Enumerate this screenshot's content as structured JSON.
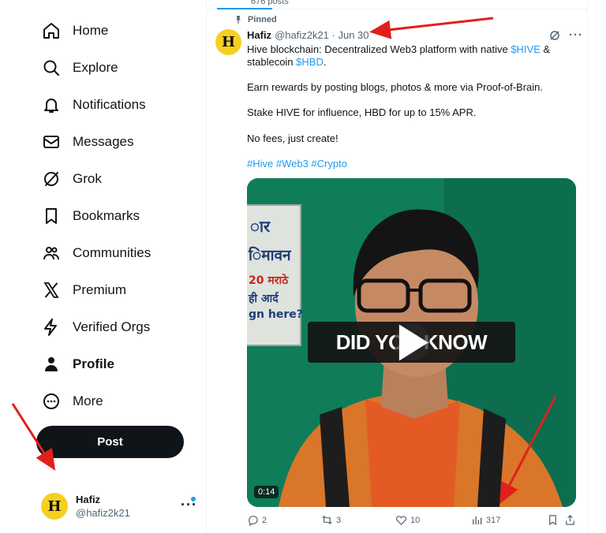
{
  "sidebar": {
    "items": [
      {
        "label": "Home",
        "icon": "home-icon"
      },
      {
        "label": "Explore",
        "icon": "search-icon"
      },
      {
        "label": "Notifications",
        "icon": "bell-icon"
      },
      {
        "label": "Messages",
        "icon": "envelope-icon"
      },
      {
        "label": "Grok",
        "icon": "grok-icon"
      },
      {
        "label": "Bookmarks",
        "icon": "bookmark-icon"
      },
      {
        "label": "Communities",
        "icon": "communities-icon"
      },
      {
        "label": "Premium",
        "icon": "x-logo-icon"
      },
      {
        "label": "Verified Orgs",
        "icon": "lightning-icon"
      },
      {
        "label": "Profile",
        "icon": "person-icon"
      },
      {
        "label": "More",
        "icon": "more-circle-icon"
      }
    ],
    "post_label": "Post",
    "account": {
      "name": "Hafiz",
      "handle": "@hafiz2k21"
    }
  },
  "profile": {
    "posts_count": "676 posts"
  },
  "tweet": {
    "pinned_label": "Pinned",
    "author_name": "Hafiz",
    "author_handle": "@hafiz2k21 · Jun 30",
    "text": {
      "line1_pre": "Hive blockchain: Decentralized Web3 platform with native ",
      "cashtag1": "$HIVE",
      "line1_post": " &",
      "line2_pre": "stablecoin ",
      "cashtag2": "$HBD",
      "line2_post": ".",
      "para2": "Earn rewards by posting blogs, photos & more via Proof-of-Brain.",
      "para3": "Stake HIVE for influence, HBD for up to 15% APR.",
      "para4": "No fees, just create!",
      "hashtags": "#Hive #Web3 #Crypto"
    },
    "media": {
      "overlay_text": "DID YOU KNOW",
      "duration": "0:14",
      "sign_lines": [
        "ार",
        "िमावन",
        "20 मराठे",
        "ही आर्द",
        "gn here?"
      ]
    },
    "stats": {
      "replies": "2",
      "reposts": "3",
      "likes": "10",
      "views": "317"
    }
  },
  "colors": {
    "accent": "#1d9bf0",
    "annotation": "#e0201b",
    "text": "#0f1419",
    "muted": "#536471"
  }
}
